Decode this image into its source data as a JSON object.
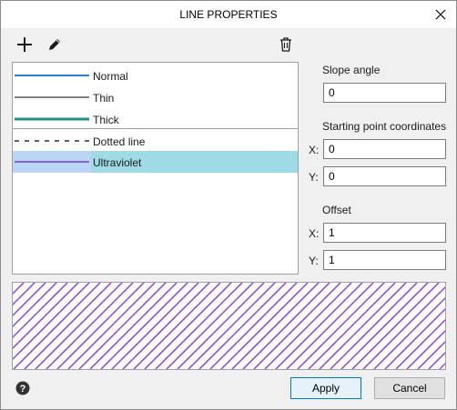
{
  "window": {
    "title": "LINE PROPERTIES"
  },
  "toolbar": {
    "add_icon": "plus-icon",
    "edit_icon": "pencil-icon",
    "delete_icon": "trash-icon"
  },
  "line_list": {
    "items": [
      {
        "label": "Normal",
        "style": "solid",
        "color": "#2f7fd8",
        "width": 2
      },
      {
        "label": "Thin",
        "style": "solid",
        "color": "#000000",
        "width": 1
      },
      {
        "label": "Thick",
        "style": "solid",
        "color": "#1f8f8f",
        "width": 3
      },
      {
        "label": "Dotted line",
        "style": "dashed",
        "color": "#000000",
        "width": 1
      },
      {
        "label": "Ultraviolet",
        "style": "solid",
        "color": "#6a3ed8",
        "width": 1.5,
        "selected": true
      }
    ]
  },
  "properties": {
    "slope_angle": {
      "label": "Slope angle",
      "value": "0"
    },
    "start_point": {
      "label": "Starting point coordinates",
      "x_label": "X:",
      "x_value": "0",
      "y_label": "Y:",
      "y_value": "0"
    },
    "offset": {
      "label": "Offset",
      "x_label": "X:",
      "x_value": "1",
      "y_label": "Y:",
      "y_value": "1"
    }
  },
  "preview": {
    "hatch_color": "#8a3fe6"
  },
  "footer": {
    "help_icon": "help-icon",
    "apply_label": "Apply",
    "cancel_label": "Cancel"
  }
}
